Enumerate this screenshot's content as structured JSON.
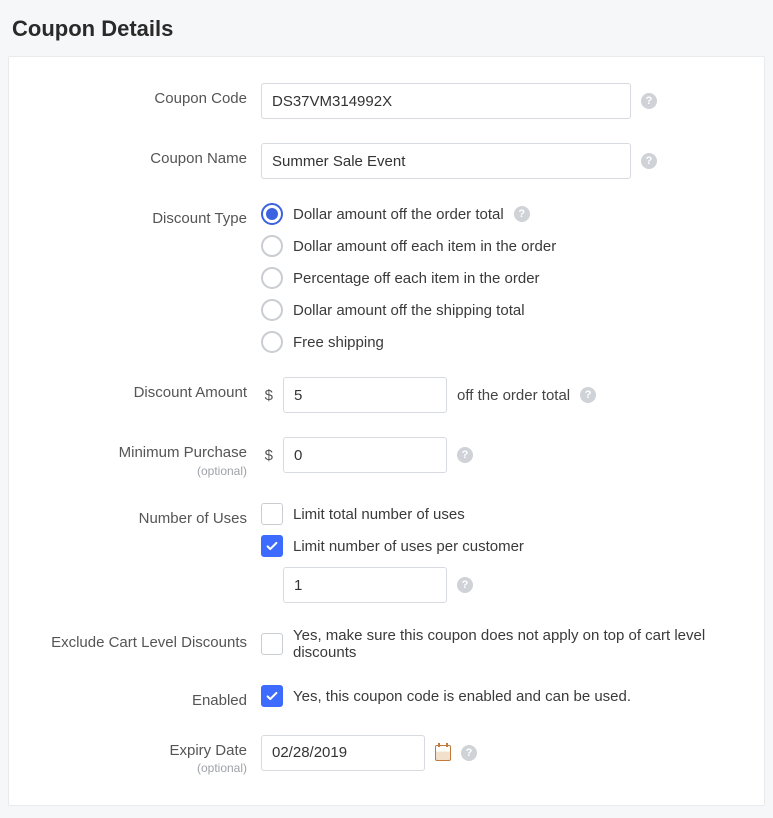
{
  "title": "Coupon Details",
  "helpGlyph": "?",
  "dollar": "$",
  "couponCode": {
    "label": "Coupon Code",
    "value": "DS37VM314992X"
  },
  "couponName": {
    "label": "Coupon Name",
    "value": "Summer Sale Event"
  },
  "discountType": {
    "label": "Discount Type",
    "options": [
      "Dollar amount off the order total",
      "Dollar amount off each item in the order",
      "Percentage off each item in the order",
      "Dollar amount off the shipping total",
      "Free shipping"
    ],
    "selectedIndex": 0
  },
  "discountAmount": {
    "label": "Discount Amount",
    "value": "5",
    "suffix": "off the order total"
  },
  "minimumPurchase": {
    "label": "Minimum Purchase",
    "optional": "(optional)",
    "value": "0"
  },
  "numberOfUses": {
    "label": "Number of Uses",
    "limitTotal": {
      "checked": false,
      "label": "Limit total number of uses"
    },
    "limitPerCustomer": {
      "checked": true,
      "label": "Limit number of uses per customer",
      "value": "1"
    }
  },
  "excludeCartLevel": {
    "label": "Exclude Cart Level Discounts",
    "checked": false,
    "text": "Yes, make sure this coupon does not apply on top of cart level discounts"
  },
  "enabled": {
    "label": "Enabled",
    "checked": true,
    "text": "Yes, this coupon code is enabled and can be used."
  },
  "expiryDate": {
    "label": "Expiry Date",
    "optional": "(optional)",
    "value": "02/28/2019"
  }
}
